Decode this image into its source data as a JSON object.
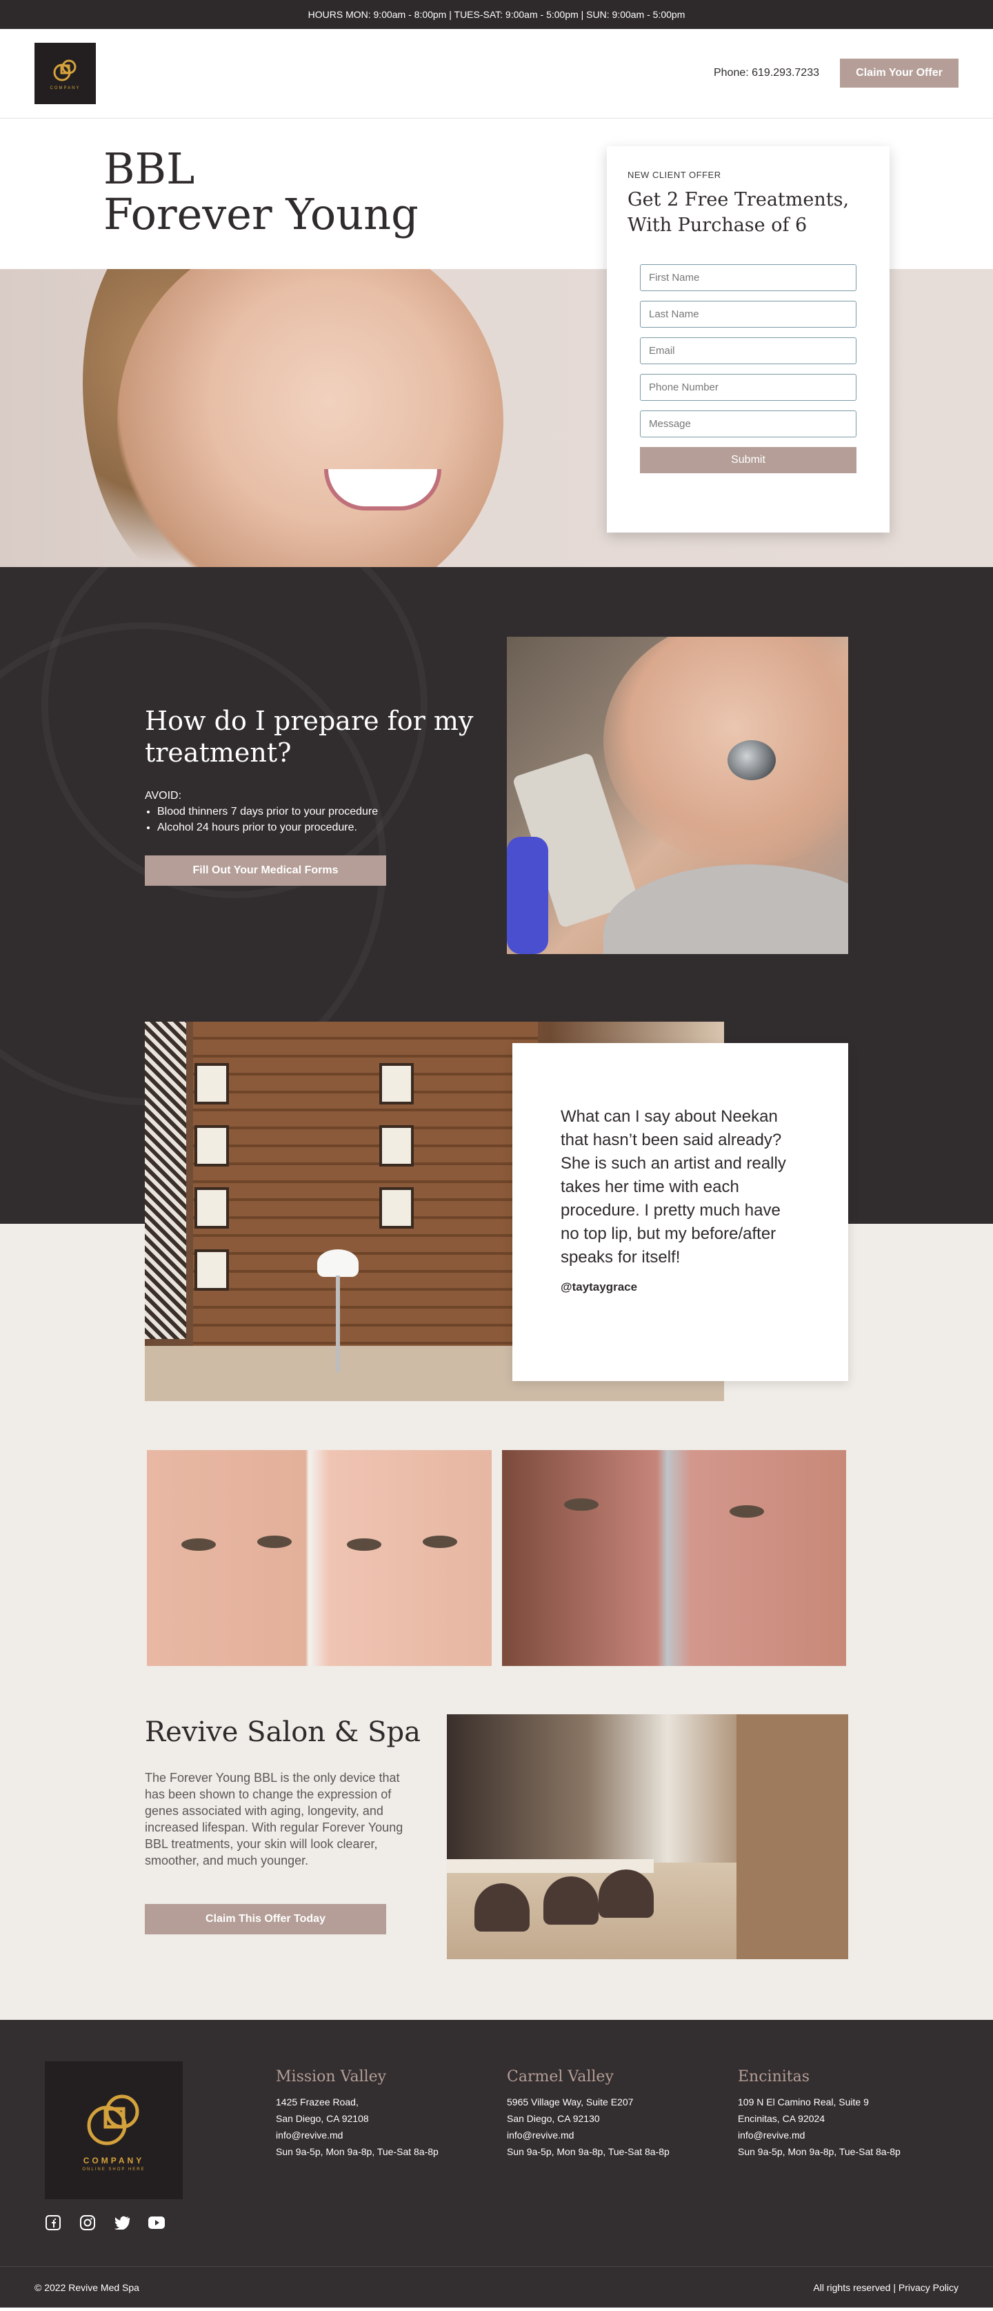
{
  "topbar": {
    "hours": "HOURS MON: 9:00am - 8:00pm | TUES-SAT: 9:00am - 5:00pm | SUN: 9:00am - 5:00pm"
  },
  "header": {
    "logo_label": "COMPANY",
    "phone": "Phone: 619.293.7233",
    "cta": "Claim Your Offer",
    "logo_icon": "interlocking-rings-logo"
  },
  "hero": {
    "title_line1": "BBL",
    "title_line2": "Forever Young",
    "offer": {
      "eyebrow": "NEW CLIENT OFFER",
      "headline": "Get 2 Free Treatments, With Purchase of 6",
      "fields": {
        "first_name": "First Name",
        "last_name": "Last Name",
        "email": "Email",
        "phone": "Phone Number",
        "message": "Message"
      },
      "submit": "Submit"
    }
  },
  "prepare": {
    "title": "How do I prepare for my treatment?",
    "avoid_label": "AVOID:",
    "items": [
      "Blood thinners 7 days prior to your procedure",
      "Alcohol 24 hours prior to your procedure."
    ],
    "button": "Fill Out Your Medical Forms"
  },
  "testimonial": {
    "quote": "What can I say about Neekan that hasn’t been said already? She is such an artist and really takes her time with each procedure. I pretty much have no top lip, but my before/after speaks for itself!",
    "handle": "@taytaygrace"
  },
  "revive": {
    "title": "Revive Salon & Spa",
    "body": "The Forever Young BBL is the only device that has been shown to change the expression of genes associated with aging, longevity, and increased lifespan. With regular Forever Young BBL treatments, your skin will look clearer, smoother, and much younger.",
    "button": "Claim This Offer Today"
  },
  "footer": {
    "logo_label": "COMPANY",
    "logo_sub": "ONLINE SHOP HERE",
    "locations": [
      {
        "name": "Mission Valley",
        "address1": "1425 Frazee Road,",
        "address2": "San Diego, CA 92108",
        "email": "info@revive.md",
        "hours": "Sun 9a-5p, Mon 9a-8p, Tue-Sat 8a-8p"
      },
      {
        "name": "Carmel Valley",
        "address1": "5965 Village Way, Suite E207",
        "address2": "San Diego, CA 92130",
        "email": "info@revive.md",
        "hours": "Sun 9a-5p, Mon 9a-8p, Tue-Sat 8a-8p"
      },
      {
        "name": "Encinitas",
        "address1": "109 N El Camino Real, Suite 9",
        "address2": "Encinitas, CA 92024",
        "email": "info@revive.md",
        "hours": "Sun 9a-5p, Mon 9a-8p, Tue-Sat 8a-8p"
      }
    ],
    "socials": [
      "facebook-icon",
      "instagram-icon",
      "twitter-icon",
      "youtube-icon"
    ],
    "copyright": "© 2022 Revive Med Spa",
    "rights": "All rights reserved | Privacy Policy"
  },
  "colors": {
    "dark": "#312c2d",
    "accent": "#b49e97",
    "beige": "#f0ece7",
    "gold": "#d4a23c"
  }
}
